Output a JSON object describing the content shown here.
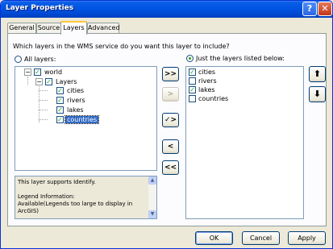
{
  "window": {
    "title": "Layer Properties",
    "help_glyph": "?",
    "close_glyph": "✕"
  },
  "tabs": [
    {
      "label": "General",
      "active": false
    },
    {
      "label": "Source",
      "active": false
    },
    {
      "label": "Layers",
      "active": true
    },
    {
      "label": "Advanced",
      "active": false
    }
  ],
  "question": "Which layers in the WMS service do you want this layer to include?",
  "radios": {
    "all_layers": {
      "label": "All layers:",
      "checked": false
    },
    "just_listed": {
      "label": "Just the layers listed below:",
      "checked": true
    }
  },
  "tree": {
    "root": {
      "label": "world",
      "checked": true,
      "expander": "−"
    },
    "group": {
      "label": "Layers",
      "checked": true,
      "expander": "−"
    },
    "children": [
      {
        "label": "cities",
        "checked": true
      },
      {
        "label": "rivers",
        "checked": true
      },
      {
        "label": "lakes",
        "checked": true
      },
      {
        "label": "countries",
        "checked": true,
        "selected": true
      }
    ]
  },
  "middle_buttons": {
    "add_all": ">>",
    "add": ">",
    "add_checked": "✓>",
    "remove": "<",
    "remove_all": "<<"
  },
  "selected_layers": [
    {
      "label": "cities",
      "checked": true
    },
    {
      "label": "rivers",
      "checked": false
    },
    {
      "label": "lakes",
      "checked": true
    },
    {
      "label": "countries",
      "checked": false
    }
  ],
  "order_buttons": {
    "up": "⬆",
    "down": "⬇"
  },
  "info_text": {
    "line1": "This layer supports Identify.",
    "line2": "Legend Information:",
    "line3": "Available(Legends too large to display in",
    "line4": "ArcGIS)"
  },
  "dialog_buttons": {
    "ok": "OK",
    "cancel": "Cancel",
    "apply": "Apply"
  }
}
